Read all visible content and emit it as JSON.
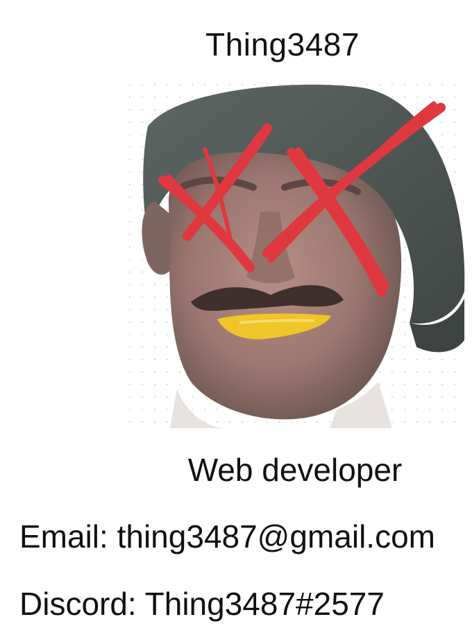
{
  "profile": {
    "name": "Thing3487",
    "photo_icon": "defaced-face-photo-icon",
    "role": "Web developer",
    "email_line": "Email: thing3487@gmail.com",
    "discord_line": "Discord: Thing3487#2577"
  },
  "colors": {
    "text": "#111111",
    "background": "#ffffff",
    "x_marks": "#e0383f",
    "mouth_paint": "#f0c52a"
  }
}
